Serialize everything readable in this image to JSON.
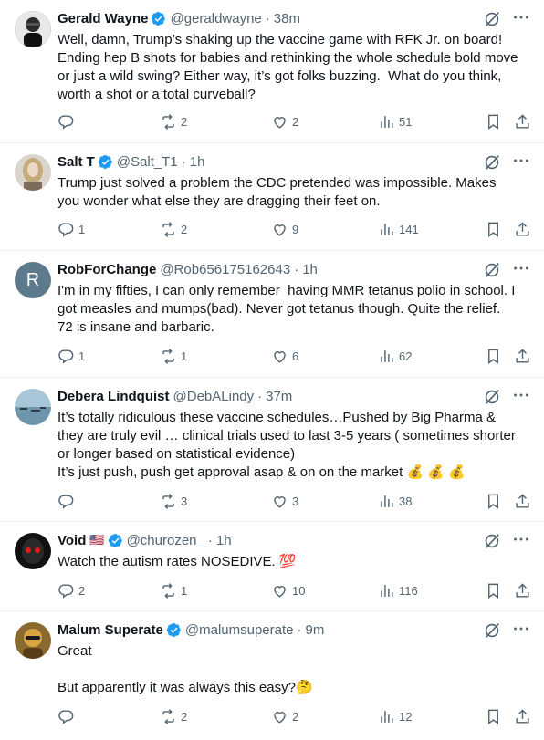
{
  "tweets": [
    {
      "name": "Gerald Wayne",
      "handle": "@geraldwayne",
      "time": "38m",
      "flag": "",
      "text": "Well, damn, Trump’s shaking up the vaccine game with RFK Jr. on board! Ending hep B shots for babies and rethinking the whole schedule bold move or just a wild swing? Either way, it’s got folks buzzing.  What do you think, worth a shot or a total curveball?",
      "replies": "",
      "reposts": "2",
      "likes": "2",
      "views": "51",
      "avatar_color": "#3a3a3a"
    },
    {
      "name": "Salt T",
      "handle": "@Salt_T1",
      "time": "1h",
      "flag": "",
      "text": "Trump just solved a problem the CDC pretended was impossible. Makes you wonder what else they are dragging their feet on.",
      "replies": "1",
      "reposts": "2",
      "likes": "9",
      "views": "141",
      "avatar_color": "#c8b79d"
    },
    {
      "name": "RobForChange",
      "handle": "@Rob656175162643",
      "time": "1h",
      "flag": "",
      "text": "I'm in my fifties, I can only remember  having MMR tetanus polio in school. I got measles and mumps(bad). Never got tetanus though. Quite the relief. 72 is insane and barbaric.",
      "replies": "1",
      "reposts": "1",
      "likes": "6",
      "views": "62",
      "avatar_letter": "R",
      "avatar_color": "#5c7a8c"
    },
    {
      "name": "Debera Lindquist",
      "handle": "@DebALindy",
      "time": "37m",
      "flag": "",
      "text": "It’s totally ridiculous these vaccine schedules…Pushed by Big Pharma & they are truly evil … clinical trials used to last 3-5 years ( sometimes shorter or longer based on statistical evidence)\nIt’s just push, push get approval asap & on on the market 💰 💰 💰",
      "replies": "",
      "reposts": "3",
      "likes": "3",
      "views": "38",
      "avatar_color": "#7fa7bf"
    },
    {
      "name": "Void",
      "handle": "@churozen_",
      "time": "1h",
      "flag": "🇺🇸",
      "text": "Watch the autism rates NOSEDIVE. 💯",
      "replies": "2",
      "reposts": "1",
      "likes": "10",
      "views": "116",
      "avatar_color": "#1a1a1a"
    },
    {
      "name": "Malum Superate",
      "handle": "@malumsuperate",
      "time": "9m",
      "flag": "",
      "text": "Great\n\nBut apparently it was always this easy?🤔",
      "replies": "",
      "reposts": "2",
      "likes": "2",
      "views": "12",
      "avatar_color": "#c9a43a"
    }
  ],
  "colors": {
    "text": "#0f1419",
    "muted": "#536471",
    "verified": "#1d9bf0",
    "divider": "#eff3f4"
  },
  "icons": [
    "verified-badge-icon",
    "grok-icon",
    "more-icon",
    "reply-icon",
    "repost-icon",
    "like-icon",
    "views-icon",
    "bookmark-icon",
    "share-icon"
  ]
}
